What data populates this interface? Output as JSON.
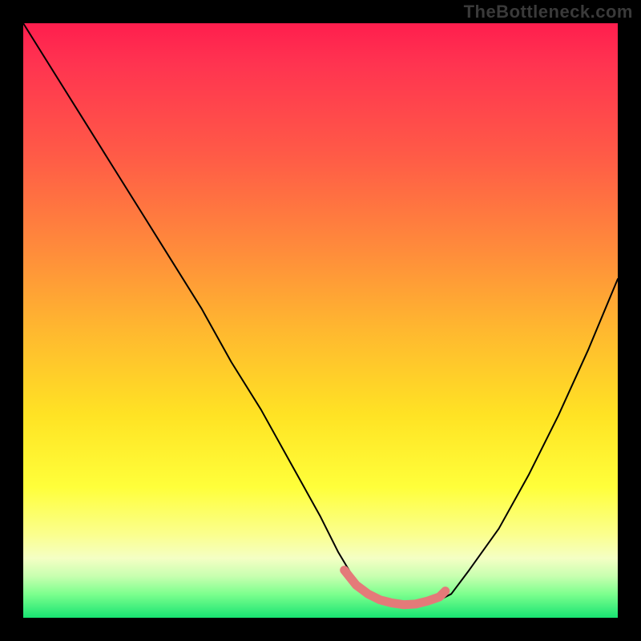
{
  "watermark": "TheBottleneck.com",
  "chart_data": {
    "type": "line",
    "title": "",
    "xlabel": "",
    "ylabel": "",
    "xlim": [
      0,
      100
    ],
    "ylim": [
      0,
      100
    ],
    "series": [
      {
        "name": "bottleneck-curve",
        "x": [
          0,
          5,
          10,
          15,
          20,
          25,
          30,
          35,
          40,
          45,
          50,
          53,
          56,
          60,
          64,
          67,
          70,
          72,
          75,
          80,
          85,
          90,
          95,
          100
        ],
        "y": [
          100,
          92,
          84,
          76,
          68,
          60,
          52,
          43,
          35,
          26,
          17,
          11,
          6,
          3,
          2,
          2,
          3,
          4,
          8,
          15,
          24,
          34,
          45,
          57
        ]
      }
    ],
    "highlight": {
      "name": "sweet-spot",
      "x": [
        54,
        56,
        58,
        60,
        62,
        64,
        66,
        68,
        70,
        71
      ],
      "y": [
        8,
        5.5,
        4,
        3,
        2.5,
        2.2,
        2.3,
        2.8,
        3.5,
        4.5
      ]
    },
    "gradient_stops": [
      {
        "pos": 0.0,
        "color": "#ff1e4e"
      },
      {
        "pos": 0.22,
        "color": "#ff5a47"
      },
      {
        "pos": 0.52,
        "color": "#ffb92f"
      },
      {
        "pos": 0.78,
        "color": "#ffff3a"
      },
      {
        "pos": 0.93,
        "color": "#c8ffb0"
      },
      {
        "pos": 1.0,
        "color": "#18e472"
      }
    ]
  }
}
